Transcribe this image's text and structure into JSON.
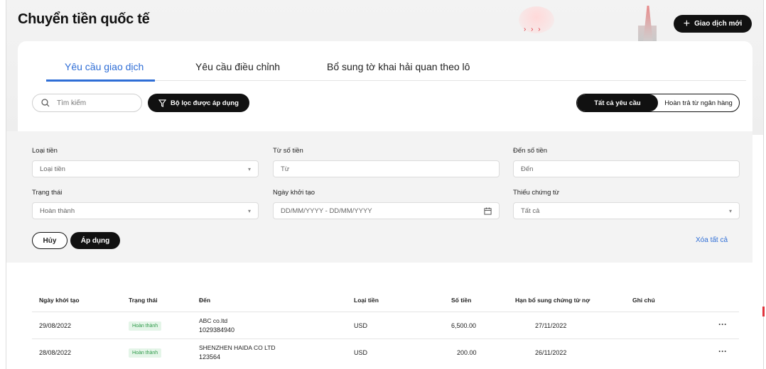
{
  "page": {
    "title": "Chuyển tiền quốc tế"
  },
  "header": {
    "new_transaction_label": "Giao dịch mới",
    "new_transaction_icon": "plus-icon"
  },
  "tabs": [
    {
      "label": "Yêu cầu giao dịch",
      "active": true
    },
    {
      "label": "Yêu cầu điều chỉnh",
      "active": false
    },
    {
      "label": "Bổ sung tờ khai hải quan theo lô",
      "active": false
    }
  ],
  "toolbar": {
    "search_placeholder": "Tìm kiếm",
    "filter_label": "Bộ lọc được áp dụng",
    "segment_all": "Tất cả yêu cầu",
    "segment_refund": "Hoàn trả từ ngân hàng"
  },
  "filters": {
    "currency_label": "Loại tiền",
    "currency_value": "Loại tiền",
    "from_amount_label": "Từ số tiền",
    "from_amount_placeholder": "Từ",
    "to_amount_label": "Đến số tiền",
    "to_amount_placeholder": "Đến",
    "status_label": "Trạng thái",
    "status_value": "Hoàn thành",
    "date_label": "Ngày khởi tạo",
    "date_placeholder": "DD/MM/YYYY - DD/MM/YYYY",
    "missing_docs_label": "Thiếu chứng từ",
    "missing_docs_value": "Tất cả",
    "cancel_label": "Hủy",
    "apply_label": "Áp dụng",
    "clear_all_label": "Xóa tất cả"
  },
  "table": {
    "headers": [
      "Ngày khởi tạo",
      "Trạng thái",
      "Đến",
      "Loại tiền",
      "Số tiền",
      "Hạn bổ sung chứng từ nợ",
      "Ghi chú"
    ],
    "rows": [
      {
        "date": "29/08/2022",
        "status": "Hoàn thành",
        "to_name": "ABC co.ltd",
        "to_account": "1029384940",
        "currency": "USD",
        "amount": "6,500.00",
        "deadline": "27/11/2022",
        "more": "···"
      },
      {
        "date": "28/08/2022",
        "status": "Hoàn thành",
        "to_name": "SHENZHEN HAIDA CO LTD",
        "to_account": "123564",
        "currency": "USD",
        "amount": "200.00",
        "deadline": "26/11/2022",
        "more": "···"
      }
    ]
  },
  "colors": {
    "accent": "#2f6ed6",
    "primary_button": "#111111",
    "success_text": "#2e9a49",
    "success_bg": "#e4f5e8"
  }
}
